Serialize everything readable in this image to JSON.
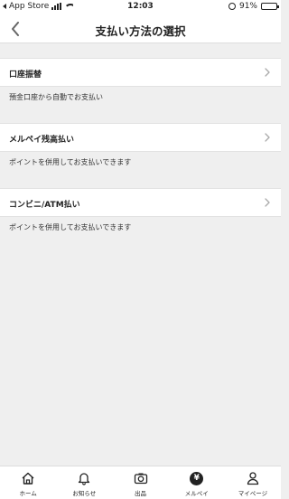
{
  "status_bar": {
    "carrier": "App Store",
    "time": "12:03",
    "battery": "91%",
    "battery_level": 0.91
  },
  "nav": {
    "title": "支払い方法の選択"
  },
  "methods": [
    {
      "label": "口座振替",
      "description": "預金口座から自動でお支払い"
    },
    {
      "label": "メルペイ残高払い",
      "description": "ポイントを併用してお支払いできます"
    },
    {
      "label": "コンビニ/ATM払い",
      "description": "ポイントを併用してお支払いできます"
    }
  ],
  "tabs": [
    {
      "label": "ホーム",
      "icon": "home-icon"
    },
    {
      "label": "お知らせ",
      "icon": "bell-icon"
    },
    {
      "label": "出品",
      "icon": "camera-icon"
    },
    {
      "label": "メルペイ",
      "icon": "yen-icon",
      "glyph": "¥"
    },
    {
      "label": "マイページ",
      "icon": "person-icon"
    }
  ]
}
